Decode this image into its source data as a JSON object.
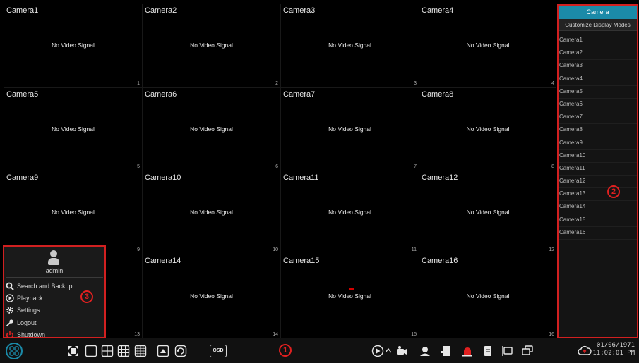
{
  "no_signal_text": "No Video Signal",
  "cameras": [
    {
      "name": "Camera1",
      "num": "1"
    },
    {
      "name": "Camera2",
      "num": "2"
    },
    {
      "name": "Camera3",
      "num": "3"
    },
    {
      "name": "Camera4",
      "num": "4"
    },
    {
      "name": "Camera5",
      "num": "5"
    },
    {
      "name": "Camera6",
      "num": "6"
    },
    {
      "name": "Camera7",
      "num": "7"
    },
    {
      "name": "Camera8",
      "num": "8"
    },
    {
      "name": "Camera9",
      "num": "9"
    },
    {
      "name": "Camera10",
      "num": "10"
    },
    {
      "name": "Camera11",
      "num": "11"
    },
    {
      "name": "Camera12",
      "num": "12"
    },
    {
      "name": "",
      "num": "13"
    },
    {
      "name": "Camera14",
      "num": "14"
    },
    {
      "name": "Camera15",
      "num": "15"
    },
    {
      "name": "Camera16",
      "num": "16"
    }
  ],
  "right_panel": {
    "tab_camera": "Camera",
    "tab_custom": "Customize Display Modes",
    "camera_list": [
      "Camera1",
      "Camera2",
      "Camera3",
      "Camera4",
      "Camera5",
      "Camera6",
      "Camera7",
      "Camera8",
      "Camera9",
      "Camera10",
      "Camera11",
      "Camera12",
      "Camera13",
      "Camera14",
      "Camera15",
      "Camera16"
    ]
  },
  "user_menu": {
    "username": "admin",
    "items": {
      "search": "Search and Backup",
      "playback": "Playback",
      "settings": "Settings",
      "logout": "Logout",
      "shutdown": "Shutdown"
    }
  },
  "taskbar": {
    "osd_label": "OSD",
    "date": "01/06/1971",
    "time": "11:02:01 PM"
  },
  "annotations": {
    "one": "1",
    "two": "2",
    "three": "3"
  },
  "colors": {
    "accent": "#1b8aa8",
    "highlight_red": "#d12020",
    "record_red": "#d40000"
  },
  "icons": [
    "start-menu-icon",
    "fullscreen-icon",
    "layout-1-icon",
    "layout-4-icon",
    "layout-9-icon",
    "layout-16-icon",
    "sequence-icon",
    "refresh-icon",
    "play-icon",
    "chevron-up-icon",
    "camera-record-icon",
    "face-icon",
    "manual-record-icon",
    "alarm-icon",
    "disk-icon",
    "network-icon",
    "dual-screen-icon",
    "cloud-icon"
  ]
}
